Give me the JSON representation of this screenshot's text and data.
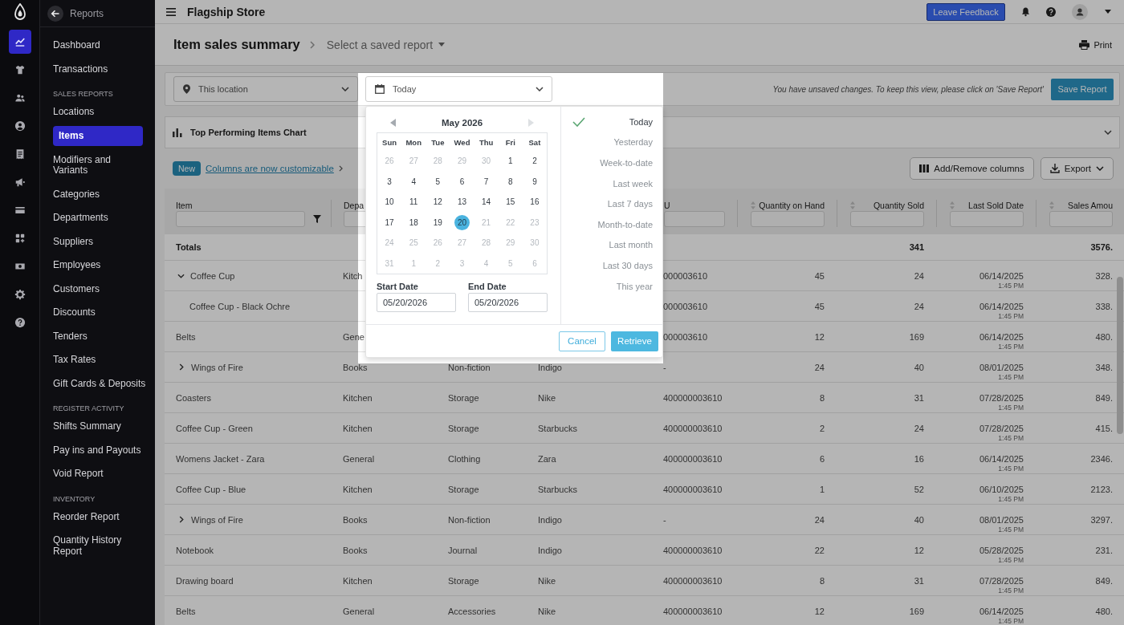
{
  "rail": [
    {
      "selected": true
    },
    {
      "selected": false
    },
    {
      "selected": false
    },
    {
      "selected": false
    },
    {
      "selected": false
    },
    {
      "selected": false
    },
    {
      "selected": false
    },
    {
      "selected": false
    },
    {
      "selected": false
    },
    {
      "selected": false
    },
    {
      "selected": false
    }
  ],
  "nav": {
    "back_label": "Reports",
    "sections": [
      {
        "items": [
          {
            "label": "Dashboard",
            "selected": false
          },
          {
            "label": "Transactions",
            "selected": false
          }
        ]
      },
      {
        "heading": "SALES REPORTS",
        "items": [
          {
            "label": "Locations",
            "selected": false
          },
          {
            "label": "Items",
            "selected": true
          },
          {
            "label": "Modifiers and Variants",
            "selected": false
          },
          {
            "label": "Categories",
            "selected": false
          },
          {
            "label": "Departments",
            "selected": false
          },
          {
            "label": "Suppliers",
            "selected": false
          },
          {
            "label": "Employees",
            "selected": false
          },
          {
            "label": "Customers",
            "selected": false
          },
          {
            "label": "Discounts",
            "selected": false
          },
          {
            "label": "Tenders",
            "selected": false
          },
          {
            "label": "Tax Rates",
            "selected": false
          },
          {
            "label": "Gift Cards & Deposits",
            "selected": false
          }
        ]
      },
      {
        "heading": "REGISTER ACTIVITY",
        "items": [
          {
            "label": "Shifts Summary",
            "selected": false
          },
          {
            "label": "Pay ins and Payouts",
            "selected": false
          },
          {
            "label": "Void Report",
            "selected": false
          }
        ]
      },
      {
        "heading": "INVENTORY",
        "items": [
          {
            "label": "Reorder Report",
            "selected": false
          },
          {
            "label": "Quantity History Report",
            "selected": false
          }
        ]
      }
    ]
  },
  "top_bar": {
    "store_name": "Flagship Store",
    "feedback_button": "Leave Feedback"
  },
  "header": {
    "title": "Item sales summary",
    "saved_report": "Select a saved report",
    "print": "Print"
  },
  "filters": {
    "location": "This location",
    "date_range": "Today",
    "notice": "You have unsaved changes. To keep this view, please click on 'Save Report'",
    "save_button": "Save Report"
  },
  "chart_panel": {
    "title": "Top Performing Items Chart",
    "expanded": false
  },
  "announcement": {
    "badge": "New",
    "link": "Columns are now customizable"
  },
  "table_tools": {
    "columns_button": "Add/Remove columns",
    "export_button": "Export"
  },
  "table": {
    "columns": [
      {
        "kind": "text",
        "label": "Item",
        "sortable": false,
        "filter_field": true,
        "filter_button": true
      },
      {
        "kind": "text",
        "label": "Depa",
        "filter_field": true
      },
      {
        "kind": "text"
      },
      {
        "kind": "text"
      },
      {
        "kind": "text",
        "label": "U",
        "filter_field": true
      },
      {
        "kind": "number",
        "label": "Quantity on Hand",
        "sortable": true,
        "filter_field": true,
        "filter_button": false
      },
      {
        "kind": "number",
        "label": "Quantity Sold",
        "sortable": true,
        "filter_field": true,
        "filter_button": false
      },
      {
        "kind": "date",
        "label": "Last Sold Date",
        "sortable": true,
        "filter_field": true,
        "filter_button": false
      },
      {
        "kind": "number",
        "label": "Sales Amou",
        "sortable": true,
        "filter_field": true,
        "filter_button": false
      }
    ],
    "totals": {
      "label": "Totals",
      "values": {
        "quantity_sold": "341",
        "column_9": "3576."
      }
    },
    "rows": [
      {
        "kind": "group",
        "expanded": true,
        "cells": {
          "item": "Coffee Cup",
          "column_2": "Kitch",
          "column_5": "000003610",
          "quantity_on_hand": "45",
          "quantity_sold": "24",
          "last_sold_date": {
            "date": "06/14/2025",
            "time": "1:45 PM"
          },
          "column_9": "328."
        },
        "children": [
          {
            "kind": "item",
            "cells": {
              "item": "Coffee Cup - Black Ochre",
              "column_5": "000003610",
              "quantity_on_hand": "45",
              "quantity_sold": "24",
              "last_sold_date": {
                "date": "06/14/2025",
                "time": "1:45 PM"
              },
              "column_9": "338."
            }
          }
        ]
      },
      {
        "kind": "item",
        "cells": {
          "item": "Belts",
          "column_2": "Gene",
          "column_5": "000003610",
          "quantity_on_hand": "12",
          "quantity_sold": "169",
          "last_sold_date": {
            "date": "06/14/2025",
            "time": "1:45 PM"
          },
          "column_9": "480."
        }
      },
      {
        "kind": "group",
        "expanded": false,
        "cells": {
          "item": "Wings of Fire",
          "column_2": "Books",
          "column_3": "Non-fiction",
          "column_4": "Indigo",
          "column_5": "-",
          "quantity_on_hand": "24",
          "quantity_sold": "40",
          "last_sold_date": {
            "date": "08/01/2025",
            "time": "1:45 PM"
          },
          "column_9": "348."
        }
      },
      {
        "kind": "item",
        "cells": {
          "item": "Coasters",
          "column_2": "Kitchen",
          "column_3": "Storage",
          "column_4": "Nike",
          "column_5": "400000003610",
          "quantity_on_hand": "8",
          "quantity_sold": "31",
          "last_sold_date": {
            "date": "07/28/2025",
            "time": "1:45 PM"
          },
          "column_9": "849."
        }
      },
      {
        "kind": "item",
        "cells": {
          "item": "Coffee Cup - Green",
          "column_2": "Kitchen",
          "column_3": "Storage",
          "column_4": "Starbucks",
          "column_5": "400000003610",
          "quantity_on_hand": "2",
          "quantity_sold": "24",
          "last_sold_date": {
            "date": "07/28/2025",
            "time": "1:45 PM"
          },
          "column_9": "415."
        }
      },
      {
        "kind": "item",
        "cells": {
          "item": "Womens Jacket - Zara",
          "column_2": "General",
          "column_3": "Clothing",
          "column_4": "Zara",
          "column_5": "400000003610",
          "quantity_on_hand": "6",
          "quantity_sold": "16",
          "last_sold_date": {
            "date": "06/14/2025",
            "time": "1:45 PM"
          },
          "column_9": "2346."
        }
      },
      {
        "kind": "item",
        "cells": {
          "item": "Coffee Cup - Blue",
          "column_2": "Kitchen",
          "column_3": "Storage",
          "column_4": "Starbucks",
          "column_5": "400000003610",
          "quantity_on_hand": "1",
          "quantity_sold": "52",
          "last_sold_date": {
            "date": "06/10/2025",
            "time": "1:45 PM"
          },
          "column_9": "2123."
        }
      },
      {
        "kind": "group",
        "expanded": false,
        "cells": {
          "item": "Wings of Fire",
          "column_2": "Books",
          "column_3": "Non-fiction",
          "column_4": "Indigo",
          "column_5": "-",
          "quantity_on_hand": "24",
          "quantity_sold": "40",
          "last_sold_date": {
            "date": "08/01/2025",
            "time": "1:45 PM"
          },
          "column_9": "3297."
        }
      },
      {
        "kind": "item",
        "cells": {
          "item": "Notebook",
          "column_2": "Books",
          "column_3": "Journal",
          "column_4": "Indigo",
          "column_5": "400000003610",
          "quantity_on_hand": "22",
          "quantity_sold": "12",
          "last_sold_date": {
            "date": "05/28/2025",
            "time": "1:45 PM"
          },
          "column_9": "231."
        }
      },
      {
        "kind": "item",
        "cells": {
          "item": "Drawing board",
          "column_2": "Kitchen",
          "column_3": "Storage",
          "column_4": "Nike",
          "column_5": "400000003610",
          "quantity_on_hand": "8",
          "quantity_sold": "31",
          "last_sold_date": {
            "date": "07/28/2025",
            "time": "1:45 PM"
          },
          "column_9": "849."
        }
      },
      {
        "kind": "item",
        "cells": {
          "item": "Belts",
          "column_2": "General",
          "column_3": "Accessories",
          "column_4": "Nike",
          "column_5": "400000003610",
          "quantity_on_hand": "12",
          "quantity_sold": "169",
          "last_sold_date": {
            "date": "06/14/2025",
            "time": "1:45 PM"
          },
          "column_9": "480."
        }
      }
    ]
  },
  "date_picker": {
    "calendar": {
      "month": "May 2026",
      "previous_disabled": false,
      "next_disabled": true,
      "weekdays": [
        "Sun",
        "Mon",
        "Tue",
        "Wed",
        "Thu",
        "Fri",
        "Sat"
      ],
      "weeks": [
        [
          {
            "day": "26",
            "disabled": true,
            "selected": false
          },
          {
            "day": "27",
            "disabled": true,
            "selected": false
          },
          {
            "day": "28",
            "disabled": true,
            "selected": false
          },
          {
            "day": "29",
            "disabled": true,
            "selected": false
          },
          {
            "day": "30",
            "disabled": true,
            "selected": false
          },
          {
            "day": "1",
            "disabled": false,
            "selected": false
          },
          {
            "day": "2",
            "disabled": false,
            "selected": false
          }
        ],
        [
          {
            "day": "3",
            "disabled": false,
            "selected": false
          },
          {
            "day": "4",
            "disabled": false,
            "selected": false
          },
          {
            "day": "5",
            "disabled": false,
            "selected": false
          },
          {
            "day": "6",
            "disabled": false,
            "selected": false
          },
          {
            "day": "7",
            "disabled": false,
            "selected": false
          },
          {
            "day": "8",
            "disabled": false,
            "selected": false
          },
          {
            "day": "9",
            "disabled": false,
            "selected": false
          }
        ],
        [
          {
            "day": "10",
            "disabled": false,
            "selected": false
          },
          {
            "day": "11",
            "disabled": false,
            "selected": false
          },
          {
            "day": "12",
            "disabled": false,
            "selected": false
          },
          {
            "day": "13",
            "disabled": false,
            "selected": false
          },
          {
            "day": "14",
            "disabled": false,
            "selected": false
          },
          {
            "day": "15",
            "disabled": false,
            "selected": false
          },
          {
            "day": "16",
            "disabled": false,
            "selected": false
          }
        ],
        [
          {
            "day": "17",
            "disabled": false,
            "selected": false
          },
          {
            "day": "18",
            "disabled": false,
            "selected": false
          },
          {
            "day": "19",
            "disabled": false,
            "selected": false
          },
          {
            "day": "20",
            "disabled": false,
            "selected": true
          },
          {
            "day": "21",
            "disabled": true,
            "selected": false
          },
          {
            "day": "22",
            "disabled": true,
            "selected": false
          },
          {
            "day": "23",
            "disabled": true,
            "selected": false
          }
        ],
        [
          {
            "day": "24",
            "disabled": true,
            "selected": false
          },
          {
            "day": "25",
            "disabled": true,
            "selected": false
          },
          {
            "day": "26",
            "disabled": true,
            "selected": false
          },
          {
            "day": "27",
            "disabled": true,
            "selected": false
          },
          {
            "day": "28",
            "disabled": true,
            "selected": false
          },
          {
            "day": "29",
            "disabled": true,
            "selected": false
          },
          {
            "day": "30",
            "disabled": true,
            "selected": false
          }
        ],
        [
          {
            "day": "31",
            "disabled": true,
            "selected": false
          },
          {
            "day": "1",
            "disabled": true,
            "selected": false
          },
          {
            "day": "2",
            "disabled": true,
            "selected": false
          },
          {
            "day": "3",
            "disabled": true,
            "selected": false
          },
          {
            "day": "4",
            "disabled": true,
            "selected": false
          },
          {
            "day": "5",
            "disabled": true,
            "selected": false
          },
          {
            "day": "6",
            "disabled": true,
            "selected": false
          }
        ]
      ]
    },
    "start_date": {
      "label": "Start Date",
      "value": "05/20/2026"
    },
    "end_date": {
      "label": "End Date",
      "value": "05/20/2026"
    },
    "presets": [
      {
        "label": "Today",
        "selected": true
      },
      {
        "label": "Yesterday",
        "selected": false
      },
      {
        "label": "Week-to-date",
        "selected": false
      },
      {
        "label": "Last week",
        "selected": false
      },
      {
        "label": "Last 7 days",
        "selected": false
      },
      {
        "label": "Month-to-date",
        "selected": false
      },
      {
        "label": "Last month",
        "selected": false
      },
      {
        "label": "Last 30 days",
        "selected": false
      },
      {
        "label": "This year",
        "selected": false
      }
    ],
    "cancel_button": "Cancel",
    "retrieve_button": "Retrieve"
  }
}
